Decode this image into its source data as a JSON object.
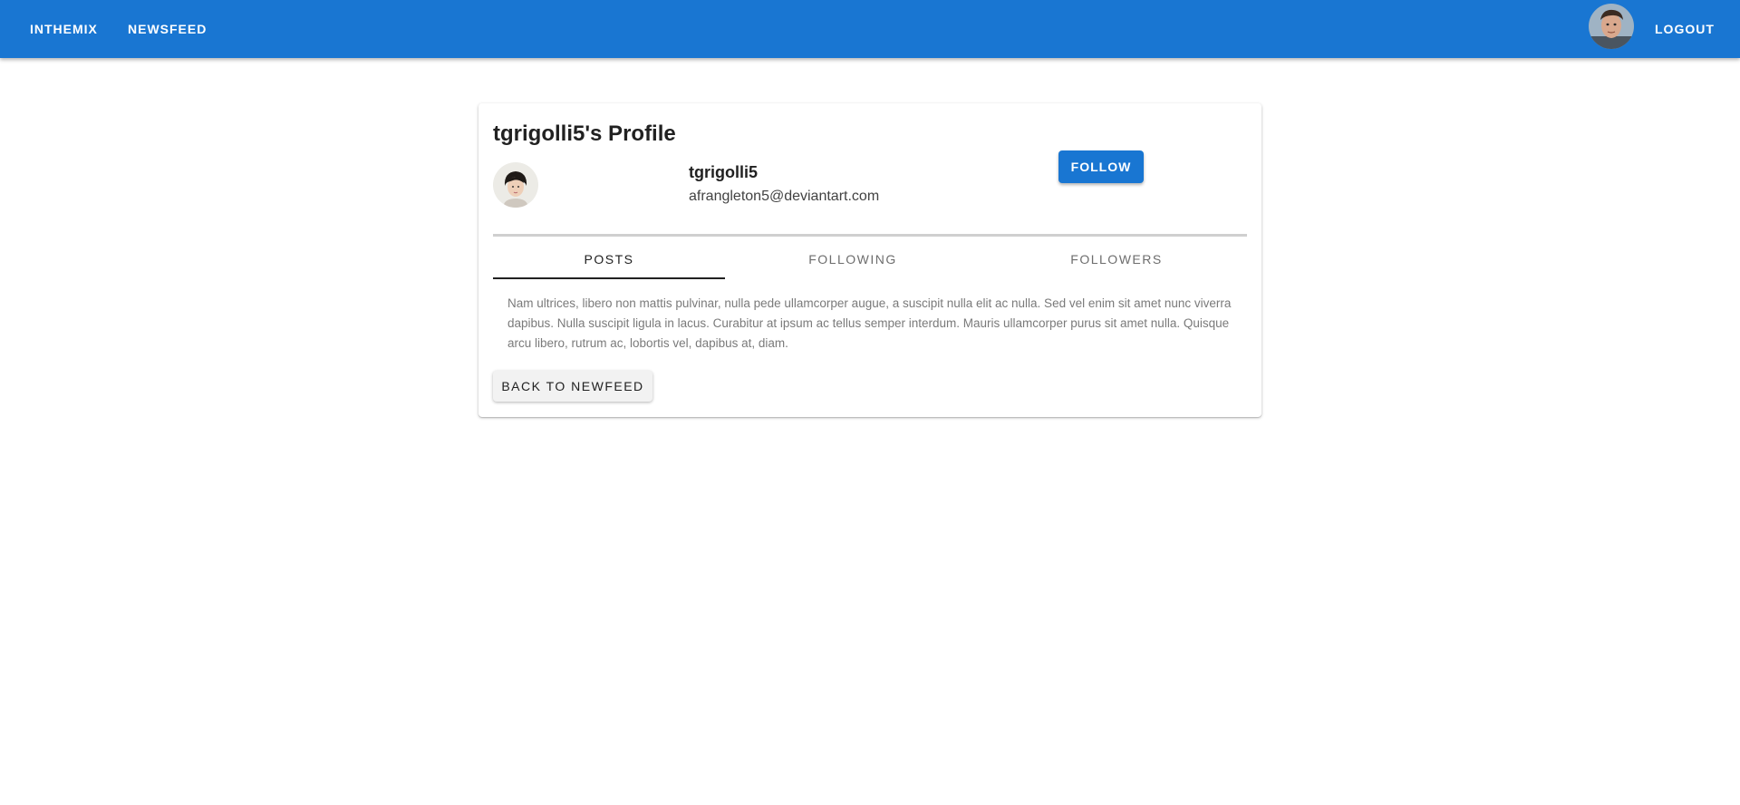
{
  "header": {
    "brand_label": "INTHEMIX",
    "newsfeed_label": "NEWSFEED",
    "logout_label": "LOGOUT",
    "color": "#1976d2"
  },
  "profile": {
    "title": "tgrigolli5's Profile",
    "username": "tgrigolli5",
    "email": "afrangleton5@deviantart.com",
    "follow_label": "FOLLOW"
  },
  "tabs": [
    {
      "label": "POSTS",
      "active": true
    },
    {
      "label": "FOLLOWING",
      "active": false
    },
    {
      "label": "FOLLOWERS",
      "active": false
    }
  ],
  "posts": [
    {
      "text": "Nam ultrices, libero non mattis pulvinar, nulla pede ullamcorper augue, a suscipit nulla elit ac nulla. Sed vel enim sit amet nunc viverra dapibus. Nulla suscipit ligula in lacus. Curabitur at ipsum ac tellus semper interdum. Mauris ullamcorper purus sit amet nulla. Quisque arcu libero, rutrum ac, lobortis vel, dapibus at, diam."
    }
  ],
  "back_label": "BACK TO NEWFEED"
}
